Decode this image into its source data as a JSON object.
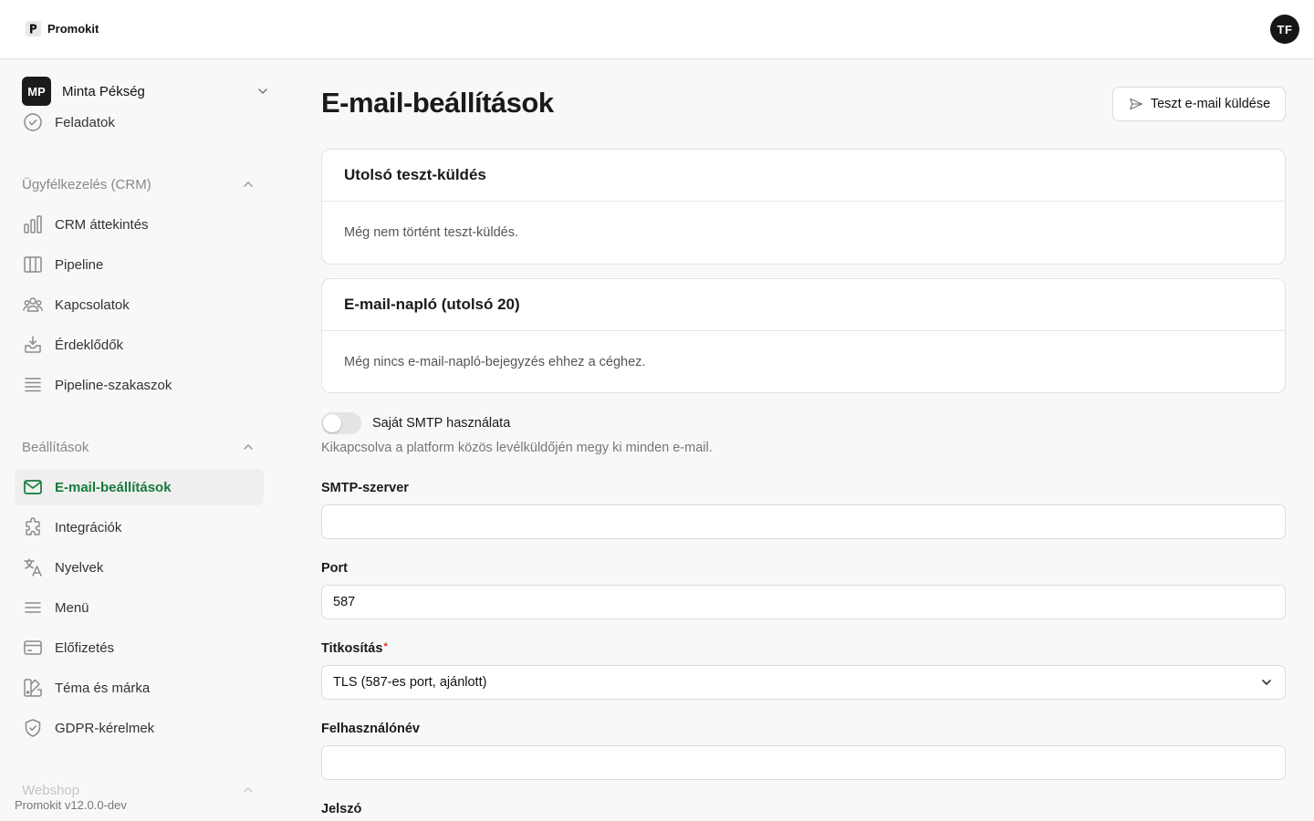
{
  "brand": {
    "name": "Promokit"
  },
  "user": {
    "initials": "TF"
  },
  "company": {
    "initials": "MP",
    "name": "Minta Pékség"
  },
  "sidebar": {
    "top_items": [
      {
        "label": "Feladatok",
        "icon": "check-circle-icon"
      }
    ],
    "crm": {
      "title": "Ügyfélkezelés (CRM)",
      "items": [
        {
          "label": "CRM áttekintés",
          "icon": "bar-chart-icon"
        },
        {
          "label": "Pipeline",
          "icon": "columns-icon"
        },
        {
          "label": "Kapcsolatok",
          "icon": "users-icon"
        },
        {
          "label": "Érdeklődők",
          "icon": "inbox-icon"
        },
        {
          "label": "Pipeline-szakaszok",
          "icon": "list-icon"
        }
      ]
    },
    "settings": {
      "title": "Beállítások",
      "items": [
        {
          "label": "E-mail-beállítások",
          "icon": "mail-icon",
          "active": true
        },
        {
          "label": "Integrációk",
          "icon": "puzzle-icon"
        },
        {
          "label": "Nyelvek",
          "icon": "translate-icon"
        },
        {
          "label": "Menü",
          "icon": "menu-icon"
        },
        {
          "label": "Előfizetés",
          "icon": "credit-card-icon"
        },
        {
          "label": "Téma és márka",
          "icon": "palette-icon"
        },
        {
          "label": "GDPR-kérelmek",
          "icon": "shield-check-icon"
        }
      ]
    },
    "webshop": {
      "title": "Webshop"
    },
    "version": "Promokit v12.0.0-dev"
  },
  "main": {
    "title": "E-mail-beállítások",
    "test_button_label": "Teszt e-mail küldése",
    "last_test": {
      "title": "Utolsó teszt-küldés",
      "empty_text": "Még nem történt teszt-küldés."
    },
    "email_log": {
      "title": "E-mail-napló (utolsó 20)",
      "empty_text": "Még nincs e-mail-napló-bejegyzés ehhez a céghez."
    },
    "smtp_toggle": {
      "label": "Saját SMTP használata",
      "enabled": false,
      "hint": "Kikapcsolva a platform közös levélküldőjén megy ki minden e-mail."
    },
    "fields": {
      "server": {
        "label": "SMTP-szerver",
        "value": ""
      },
      "port": {
        "label": "Port",
        "value": "587"
      },
      "encryption": {
        "label": "Titkosítás",
        "required_mark": "*",
        "value": "TLS (587-es port, ajánlott)"
      },
      "username": {
        "label": "Felhasználónév",
        "value": ""
      },
      "password": {
        "label": "Jelszó"
      }
    }
  },
  "colors": {
    "accent": "#167a3a",
    "required": "#d93025"
  }
}
